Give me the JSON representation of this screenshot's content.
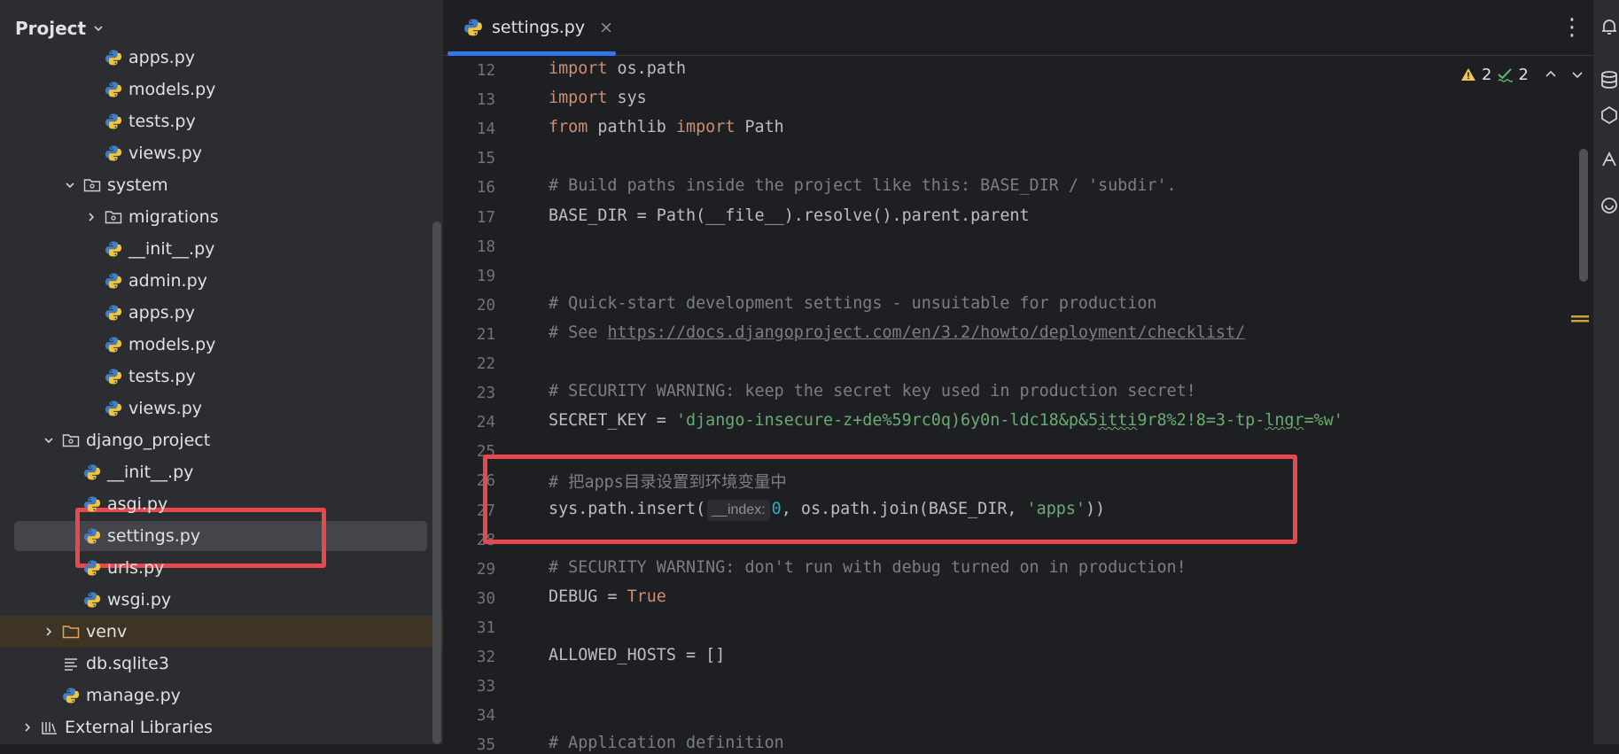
{
  "project_panel": {
    "title": "Project",
    "tree": [
      {
        "label": "apps.py",
        "depth": 3,
        "type": "py"
      },
      {
        "label": "models.py",
        "depth": 3,
        "type": "py"
      },
      {
        "label": "tests.py",
        "depth": 3,
        "type": "py"
      },
      {
        "label": "views.py",
        "depth": 3,
        "type": "py"
      },
      {
        "label": "system",
        "depth": 2,
        "type": "pkg",
        "expanded": true
      },
      {
        "label": "migrations",
        "depth": 3,
        "type": "pkg",
        "expanded": false
      },
      {
        "label": "__init__.py",
        "depth": 3,
        "type": "py"
      },
      {
        "label": "admin.py",
        "depth": 3,
        "type": "py"
      },
      {
        "label": "apps.py",
        "depth": 3,
        "type": "py"
      },
      {
        "label": "models.py",
        "depth": 3,
        "type": "py"
      },
      {
        "label": "tests.py",
        "depth": 3,
        "type": "py"
      },
      {
        "label": "views.py",
        "depth": 3,
        "type": "py"
      },
      {
        "label": "django_project",
        "depth": 1,
        "type": "pkg",
        "expanded": true
      },
      {
        "label": "__init__.py",
        "depth": 2,
        "type": "py"
      },
      {
        "label": "asgi.py",
        "depth": 2,
        "type": "py"
      },
      {
        "label": "settings.py",
        "depth": 2,
        "type": "py",
        "selected": true
      },
      {
        "label": "urls.py",
        "depth": 2,
        "type": "py"
      },
      {
        "label": "wsgi.py",
        "depth": 2,
        "type": "py"
      },
      {
        "label": "venv",
        "depth": 1,
        "type": "folder",
        "expanded": false,
        "highlight": true
      },
      {
        "label": "db.sqlite3",
        "depth": 1,
        "type": "text"
      },
      {
        "label": "manage.py",
        "depth": 1,
        "type": "py"
      },
      {
        "label": "External Libraries",
        "depth": 0,
        "type": "lib",
        "expanded": false
      }
    ]
  },
  "editor": {
    "tab": {
      "label": "settings.py",
      "close": "×"
    },
    "more_icon": "⋮",
    "inspections": {
      "warnings": "2",
      "weak_warnings": "2"
    },
    "line_numbers": [
      "12",
      "13",
      "14",
      "15",
      "16",
      "17",
      "18",
      "19",
      "20",
      "21",
      "22",
      "23",
      "24",
      "25",
      "26",
      "27",
      "28",
      "29",
      "30",
      "31",
      "32",
      "33",
      "34",
      "35"
    ],
    "code": [
      {
        "line": 12,
        "tokens": [
          {
            "t": "import",
            "c": "kw"
          },
          {
            "t": " os.path"
          }
        ]
      },
      {
        "line": 13,
        "tokens": [
          {
            "t": "import",
            "c": "kw"
          },
          {
            "t": " sys"
          }
        ]
      },
      {
        "line": 14,
        "tokens": [
          {
            "t": "from",
            "c": "kw"
          },
          {
            "t": " pathlib "
          },
          {
            "t": "import",
            "c": "kw"
          },
          {
            "t": " Path"
          }
        ]
      },
      {
        "line": 15,
        "tokens": []
      },
      {
        "line": 16,
        "tokens": [
          {
            "t": "# Build paths inside the project like this: BASE_DIR / 'subdir'.",
            "c": "cm"
          }
        ]
      },
      {
        "line": 17,
        "tokens": [
          {
            "t": "BASE_DIR = Path(__file__).resolve().parent.parent"
          }
        ]
      },
      {
        "line": 18,
        "tokens": []
      },
      {
        "line": 19,
        "tokens": []
      },
      {
        "line": 20,
        "tokens": [
          {
            "t": "# Quick-start development settings - unsuitable for production",
            "c": "cm"
          }
        ]
      },
      {
        "line": 21,
        "tokens": [
          {
            "t": "# See ",
            "c": "cm"
          },
          {
            "t": "https://docs.djangoproject.com/en/3.2/howto/deployment/checklist/",
            "c": "link"
          }
        ]
      },
      {
        "line": 22,
        "tokens": []
      },
      {
        "line": 23,
        "tokens": [
          {
            "t": "# SECURITY WARNING: keep the secret key used in production secret!",
            "c": "cm"
          }
        ]
      },
      {
        "line": 24,
        "tokens": [
          {
            "t": "SECRET_KEY = "
          },
          {
            "t": "'django-insecure-z+de%59rc0q)6y0n-ldc18&p&5",
            "c": "str"
          },
          {
            "t": "itti",
            "c": "str squig"
          },
          {
            "t": "9r8%2!8=3-tp-",
            "c": "str"
          },
          {
            "t": "lngr",
            "c": "str squig"
          },
          {
            "t": "=%w'",
            "c": "str"
          }
        ]
      },
      {
        "line": 25,
        "tokens": []
      },
      {
        "line": 26,
        "tokens": [
          {
            "t": "# 把apps目录设置到环境变量中",
            "c": "cm"
          }
        ]
      },
      {
        "line": 27,
        "tokens": [
          {
            "t": "sys.path.insert("
          },
          {
            "t": "__index:",
            "c": "hint"
          },
          {
            "t": "0",
            "c": "num"
          },
          {
            "t": ", os.path.join(BASE_DIR, "
          },
          {
            "t": "'apps'",
            "c": "str"
          },
          {
            "t": "))"
          }
        ]
      },
      {
        "line": 28,
        "tokens": []
      },
      {
        "line": 29,
        "tokens": [
          {
            "t": "# SECURITY WARNING: don't run with debug turned on in production!",
            "c": "cm"
          }
        ]
      },
      {
        "line": 30,
        "tokens": [
          {
            "t": "DEBUG = "
          },
          {
            "t": "True",
            "c": "kw"
          }
        ]
      },
      {
        "line": 31,
        "tokens": []
      },
      {
        "line": 32,
        "tokens": [
          {
            "t": "ALLOWED_HOSTS = []"
          }
        ]
      },
      {
        "line": 33,
        "tokens": []
      },
      {
        "line": 34,
        "tokens": []
      },
      {
        "line": 35,
        "tokens": [
          {
            "t": "# Application definition",
            "c": "cm"
          }
        ]
      }
    ]
  },
  "colors": {
    "annotation_red": "#e5484d",
    "selection": "#43454a",
    "tab_underline": "#3574f0",
    "venv_highlight": "#3d3425"
  }
}
